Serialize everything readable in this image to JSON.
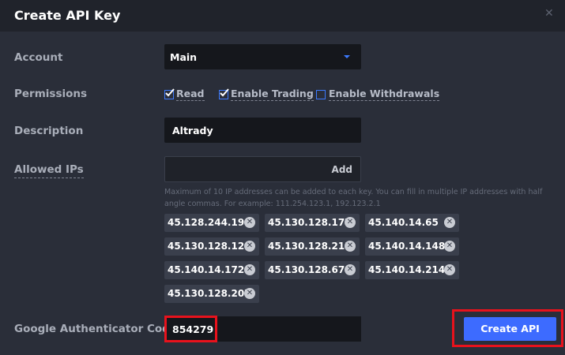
{
  "dialog": {
    "title": "Create API Key",
    "close_icon": "close-icon"
  },
  "account": {
    "label": "Account",
    "value": "Main"
  },
  "permissions": {
    "label": "Permissions",
    "options": [
      {
        "label": "Read",
        "checked": true
      },
      {
        "label": "Enable Trading",
        "checked": true
      },
      {
        "label": "Enable Withdrawals",
        "checked": false
      }
    ]
  },
  "description": {
    "label": "Description",
    "value": "Altrady"
  },
  "allowed_ips": {
    "label": "Allowed IPs",
    "add_label": "Add",
    "hint": "Maximum of 10 IP addresses can be added to each key. You can fill in multiple IP addresses with half angle commas. For example: 111.254.123.1, 192.123.2.1",
    "ips": [
      "45.128.244.199",
      "45.130.128.177",
      "45.140.14.65",
      "45.130.128.124",
      "45.130.128.215",
      "45.140.14.148",
      "45.140.14.172",
      "45.130.128.67",
      "45.140.14.214",
      "45.130.128.207"
    ]
  },
  "google_auth": {
    "label": "Google Authenticator Code",
    "value": "854279"
  },
  "create_button": {
    "label": "Create API"
  },
  "colors": {
    "accent": "#3d6bff",
    "highlight": "#e8121c",
    "background": "#2a2e39"
  }
}
